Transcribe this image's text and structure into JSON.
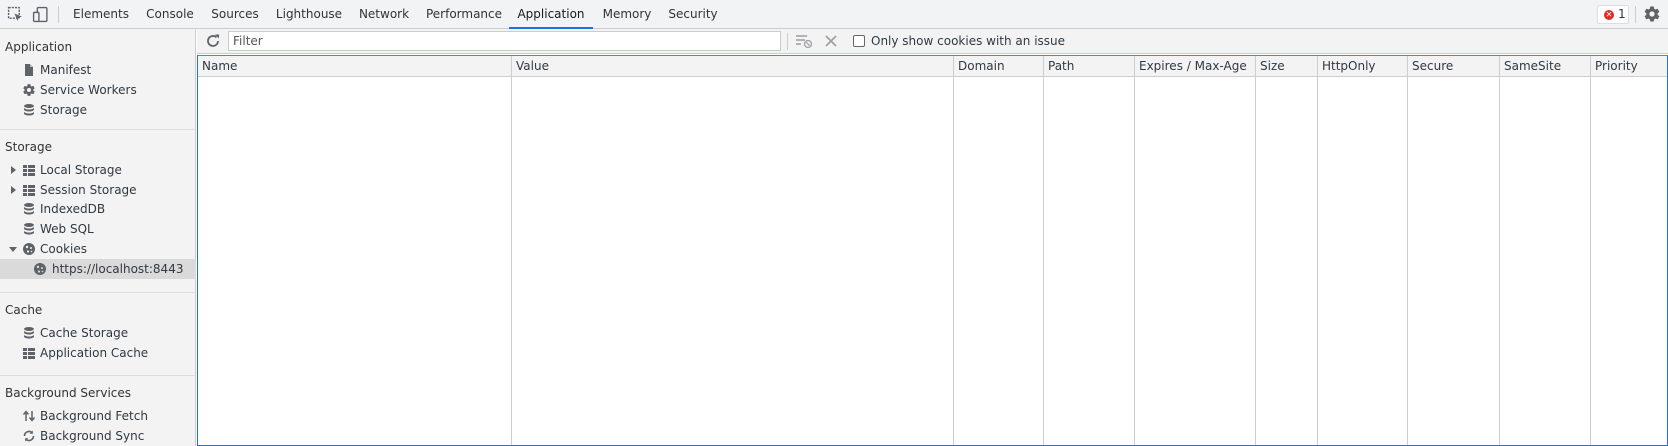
{
  "tabs": [
    {
      "label": "Elements",
      "active": false
    },
    {
      "label": "Console",
      "active": false
    },
    {
      "label": "Sources",
      "active": false
    },
    {
      "label": "Lighthouse",
      "active": false
    },
    {
      "label": "Network",
      "active": false
    },
    {
      "label": "Performance",
      "active": false
    },
    {
      "label": "Application",
      "active": true
    },
    {
      "label": "Memory",
      "active": false
    },
    {
      "label": "Security",
      "active": false
    }
  ],
  "error_count": "1",
  "sidebar": {
    "application": {
      "title": "Application",
      "items": [
        {
          "label": "Manifest",
          "icon": "document-icon"
        },
        {
          "label": "Service Workers",
          "icon": "gear-icon"
        },
        {
          "label": "Storage",
          "icon": "database-icon"
        }
      ]
    },
    "storage": {
      "title": "Storage",
      "items": [
        {
          "label": "Local Storage",
          "icon": "grid-icon",
          "expandable": true,
          "expanded": false
        },
        {
          "label": "Session Storage",
          "icon": "grid-icon",
          "expandable": true,
          "expanded": false
        },
        {
          "label": "IndexedDB",
          "icon": "database-icon"
        },
        {
          "label": "Web SQL",
          "icon": "database-icon"
        },
        {
          "label": "Cookies",
          "icon": "cookie-icon",
          "expandable": true,
          "expanded": true
        },
        {
          "label": "https://localhost:8443",
          "icon": "cookie-icon",
          "selected": true
        }
      ]
    },
    "cache": {
      "title": "Cache",
      "items": [
        {
          "label": "Cache Storage",
          "icon": "database-icon"
        },
        {
          "label": "Application Cache",
          "icon": "grid-icon"
        }
      ]
    },
    "background": {
      "title": "Background Services",
      "items": [
        {
          "label": "Background Fetch",
          "icon": "up-down-arrows-icon"
        },
        {
          "label": "Background Sync",
          "icon": "sync-icon"
        }
      ]
    }
  },
  "toolbar": {
    "filter_placeholder": "Filter",
    "filter_value": "",
    "only_issues_label": "Only show cookies with an issue",
    "only_issues_checked": false
  },
  "table": {
    "columns": [
      "Name",
      "Value",
      "Domain",
      "Path",
      "Expires / Max-Age",
      "Size",
      "HttpOnly",
      "Secure",
      "SameSite",
      "Priority"
    ],
    "rows": []
  },
  "colors": {
    "accent": "#1a73e8",
    "error": "#d93025"
  }
}
